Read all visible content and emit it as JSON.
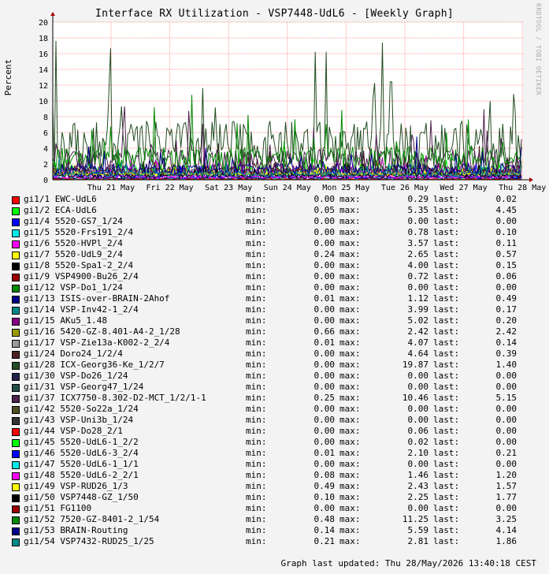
{
  "chart_data": {
    "type": "line",
    "title": "Interface RX Utilization - VSP7448-UdL6 - [Weekly Graph]",
    "ylabel": "Percent",
    "xlabel": "",
    "ylim": [
      0,
      20
    ],
    "yticks": [
      0,
      2,
      4,
      6,
      8,
      10,
      12,
      14,
      16,
      18,
      20
    ],
    "x_tick_labels": [
      "Thu 21 May",
      "Fri 22 May",
      "Sat 23 May",
      "Sun 24 May",
      "Mon 25 May",
      "Tue 26 May",
      "Wed 27 May",
      "Thu 28 May"
    ],
    "grid": true,
    "legend_placement": "below",
    "watermark": "RRDTOOL / TOBI OETIKER",
    "series": [
      {
        "name": "gi1/1 EWC-UdL6",
        "color": "#ff0000",
        "min": "0.00",
        "max": "0.29",
        "last": "0.02"
      },
      {
        "name": "gi1/2 ECA-UdL6",
        "color": "#00ff00",
        "min": "0.05",
        "max": "5.35",
        "last": "4.45"
      },
      {
        "name": "gi1/4 5520-GS7_1/24",
        "color": "#0000ff",
        "min": "0.00",
        "max": "0.00",
        "last": "0.00"
      },
      {
        "name": "gi1/5 5520-Frs191_2/4",
        "color": "#00e8e8",
        "min": "0.00",
        "max": "0.78",
        "last": "0.10"
      },
      {
        "name": "gi1/6 5520-HVPl_2/4",
        "color": "#ff00ff",
        "min": "0.00",
        "max": "3.57",
        "last": "0.11"
      },
      {
        "name": "gi1/7 5520-UdL9_2/4",
        "color": "#ffff00",
        "min": "0.24",
        "max": "2.65",
        "last": "0.57"
      },
      {
        "name": "gi1/8 5520-Spa1-2_2/4",
        "color": "#000000",
        "min": "0.00",
        "max": "4.00",
        "last": "0.15"
      },
      {
        "name": "gi1/9 VSP4900-Bu26_2/4",
        "color": "#990000",
        "min": "0.00",
        "max": "0.72",
        "last": "0.06"
      },
      {
        "name": "gi1/12 VSP-Do1_1/24",
        "color": "#008800",
        "min": "0.00",
        "max": "0.00",
        "last": "0.00"
      },
      {
        "name": "gi1/13 ISIS-over-BRAIN-2Ahof",
        "color": "#000088",
        "min": "0.01",
        "max": "1.12",
        "last": "0.49"
      },
      {
        "name": "gi1/14 VSP-Inv42-1_2/4",
        "color": "#008888",
        "min": "0.00",
        "max": "3.99",
        "last": "0.17"
      },
      {
        "name": "gi1/15 AKu5_1.48",
        "color": "#880088",
        "min": "0.00",
        "max": "5.02",
        "last": "0.20"
      },
      {
        "name": "gi1/16 5420-GZ-8.401-A4-2_1/28",
        "color": "#999900",
        "min": "0.66",
        "max": "2.42",
        "last": "2.42"
      },
      {
        "name": "gi1/17 VSP-Zie13a-K002-2_2/4",
        "color": "#999999",
        "min": "0.01",
        "max": "4.07",
        "last": "0.14"
      },
      {
        "name": "gi1/24 Doro24_1/2/4",
        "color": "#4d2222",
        "min": "0.00",
        "max": "4.64",
        "last": "0.39"
      },
      {
        "name": "gi1/28 ICX-Georg36-Ke_1/2/7",
        "color": "#224d22",
        "min": "0.00",
        "max": "19.87",
        "last": "1.40"
      },
      {
        "name": "gi1/30 VSP-Do26_1/24",
        "color": "#22224d",
        "min": "0.00",
        "max": "0.00",
        "last": "0.00"
      },
      {
        "name": "gi1/31 VSP-Georg47_1/24",
        "color": "#224d4d",
        "min": "0.00",
        "max": "0.00",
        "last": "0.00"
      },
      {
        "name": "gi1/37 ICX7750-8.302-D2-MCT_1/2/1-1",
        "color": "#4d224d",
        "min": "0.25",
        "max": "10.46",
        "last": "5.15"
      },
      {
        "name": "gi1/42 5520-So22a_1/24",
        "color": "#4d4d22",
        "min": "0.00",
        "max": "0.00",
        "last": "0.00"
      },
      {
        "name": "gi1/43 VSP-Uni3b_1/24",
        "color": "#333333",
        "min": "0.00",
        "max": "0.00",
        "last": "0.00"
      },
      {
        "name": "gi1/44 VSP-Do28_2/1",
        "color": "#ff0000",
        "min": "0.00",
        "max": "0.06",
        "last": "0.00"
      },
      {
        "name": "gi1/45 5520-UdL6-1_2/2",
        "color": "#00ff00",
        "min": "0.00",
        "max": "0.02",
        "last": "0.00"
      },
      {
        "name": "gi1/46 5520-UdL6-3_2/4",
        "color": "#0000ff",
        "min": "0.01",
        "max": "2.10",
        "last": "0.21"
      },
      {
        "name": "gi1/47 5520-UdL6-1_1/1",
        "color": "#00e8e8",
        "min": "0.00",
        "max": "0.00",
        "last": "0.00"
      },
      {
        "name": "gi1/48 5520-UdL6-2_2/1",
        "color": "#ff00ff",
        "min": "0.08",
        "max": "1.46",
        "last": "1.20"
      },
      {
        "name": "gi1/49 VSP-RUD26_1/3",
        "color": "#ffff00",
        "min": "0.49",
        "max": "2.43",
        "last": "1.57"
      },
      {
        "name": "gi1/50 VSP7448-GZ_1/50",
        "color": "#000000",
        "min": "0.10",
        "max": "2.25",
        "last": "1.77"
      },
      {
        "name": "gi1/51 FG1100",
        "color": "#990000",
        "min": "0.00",
        "max": "0.00",
        "last": "0.00"
      },
      {
        "name": "gi1/52 7520-GZ-8401-2_1/54",
        "color": "#008800",
        "min": "0.48",
        "max": "11.25",
        "last": "3.25"
      },
      {
        "name": "gi1/53 BRAIN-Routing",
        "color": "#000088",
        "min": "0.14",
        "max": "5.59",
        "last": "4.14"
      },
      {
        "name": "gi1/54 VSP7432-RUD25_1/25",
        "color": "#008888",
        "min": "0.21",
        "max": "2.81",
        "last": "1.86"
      }
    ]
  },
  "labels": {
    "min": "min:",
    "max": "max:",
    "last": "last:"
  },
  "footer": "Graph last updated: Thu 28/May/2026 13:40:18 CEST"
}
